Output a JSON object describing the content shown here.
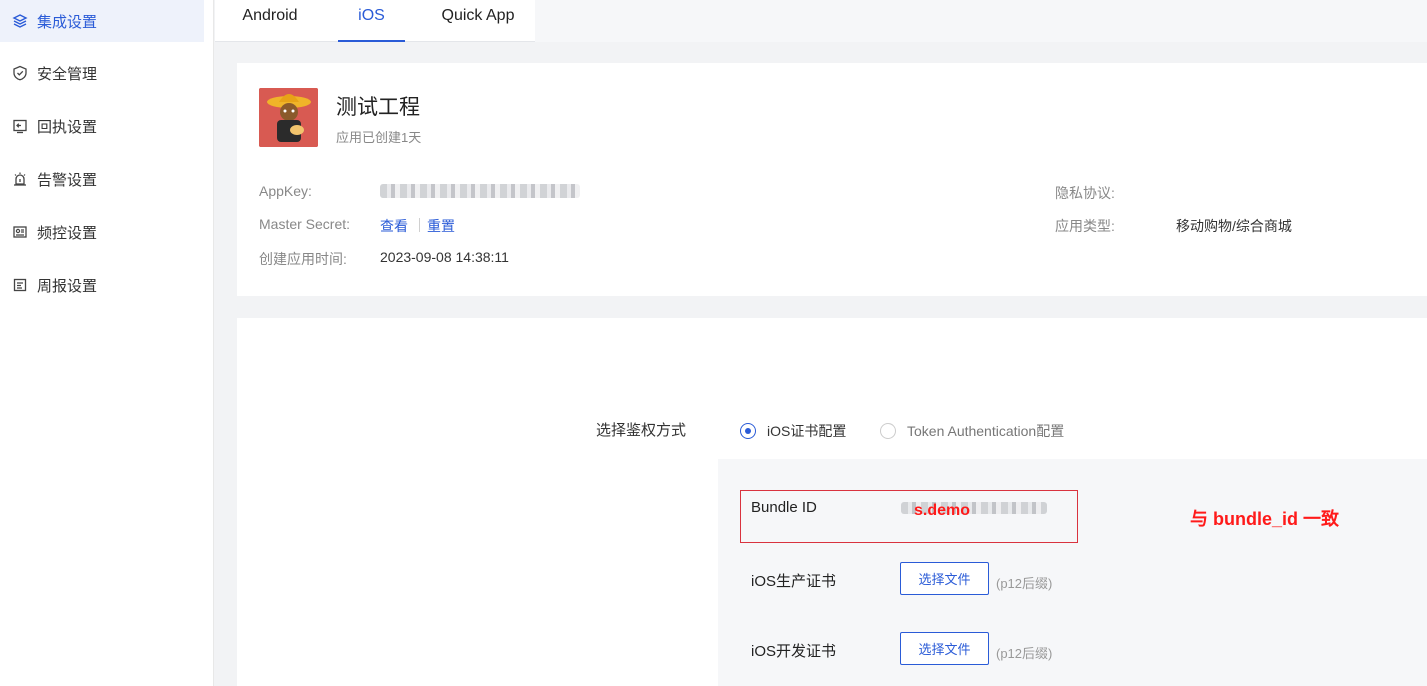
{
  "sidebar": {
    "items": [
      {
        "label": "集成设置",
        "icon": "layers-icon",
        "active": true
      },
      {
        "label": "安全管理",
        "icon": "shield-icon",
        "active": false
      },
      {
        "label": "回执设置",
        "icon": "receipt-icon",
        "active": false
      },
      {
        "label": "告警设置",
        "icon": "alarm-icon",
        "active": false
      },
      {
        "label": "频控设置",
        "icon": "frequency-icon",
        "active": false
      },
      {
        "label": "周报设置",
        "icon": "calendar-icon",
        "active": false
      }
    ]
  },
  "tabs": [
    {
      "label": "Android",
      "active": false
    },
    {
      "label": "iOS",
      "active": true
    },
    {
      "label": "Quick App",
      "active": false
    }
  ],
  "app": {
    "name": "测试工程",
    "created_text": "应用已创建1天",
    "appkey_label": "AppKey:",
    "master_secret_label": "Master Secret:",
    "view_link": "查看",
    "reset_link": "重置",
    "create_time_label": "创建应用时间:",
    "create_time_value": "2023-09-08 14:38:11",
    "privacy_label": "隐私协议:",
    "app_type_label": "应用类型:",
    "app_type_value": "移动购物/综合商城"
  },
  "config": {
    "auth_label": "选择鉴权方式",
    "auth_options": [
      {
        "label": "iOS证书配置",
        "checked": true
      },
      {
        "label": "Token Authentication配置",
        "checked": false
      }
    ],
    "bundle_id_label": "Bundle ID",
    "bundle_id_visible": "s.demo",
    "annotation": "与 bundle_id 一致",
    "prod_cert_label": "iOS生产证书",
    "dev_cert_label": "iOS开发证书",
    "choose_file_label": "选择文件",
    "file_hint": "(p12后缀)"
  },
  "colors": {
    "accent": "#2a5bd7",
    "annotation": "#ff1a1a"
  }
}
